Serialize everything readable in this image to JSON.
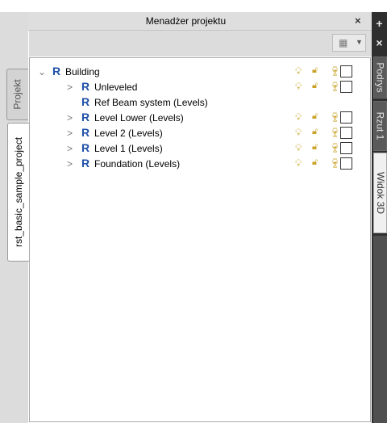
{
  "window": {
    "title": "Menadżer projektu",
    "pin_icon": "pin-icon",
    "close_glyph": "×"
  },
  "left_tabs": [
    {
      "label": "Projekt",
      "active": false
    },
    {
      "label": "rst_basic_sample_project",
      "active": true
    }
  ],
  "right_panel": {
    "plus_glyph": "+",
    "close_glyph": "×",
    "tabs": [
      {
        "label": "Podrys"
      },
      {
        "label": "Rzut 1"
      },
      {
        "label": "Widok 3D"
      }
    ]
  },
  "toolbar": {
    "filter_icon": "filter-icon",
    "dropdown_icon": "chevron-down-icon"
  },
  "tree": {
    "rows": [
      {
        "label": "Building",
        "expander": "⌄",
        "indent": 0,
        "icons": true
      },
      {
        "label": "Unleveled",
        "expander": ">",
        "indent": 1,
        "icons": true
      },
      {
        "label": "Ref Beam system (Levels)",
        "expander": "",
        "indent": 1,
        "icons": false
      },
      {
        "label": "Level Lower (Levels)",
        "expander": ">",
        "indent": 1,
        "icons": true
      },
      {
        "label": "Level 2 (Levels)",
        "expander": ">",
        "indent": 1,
        "icons": true
      },
      {
        "label": "Level 1 (Levels)",
        "expander": ">",
        "indent": 1,
        "icons": true
      },
      {
        "label": "Foundation (Levels)",
        "expander": ">",
        "indent": 1,
        "icons": true
      }
    ]
  },
  "colors": {
    "accent": "#1f4fa8",
    "icon_gold": "#c9a227",
    "panel_bg": "#dcdcdc",
    "dark_side": "#2f2f2f"
  }
}
